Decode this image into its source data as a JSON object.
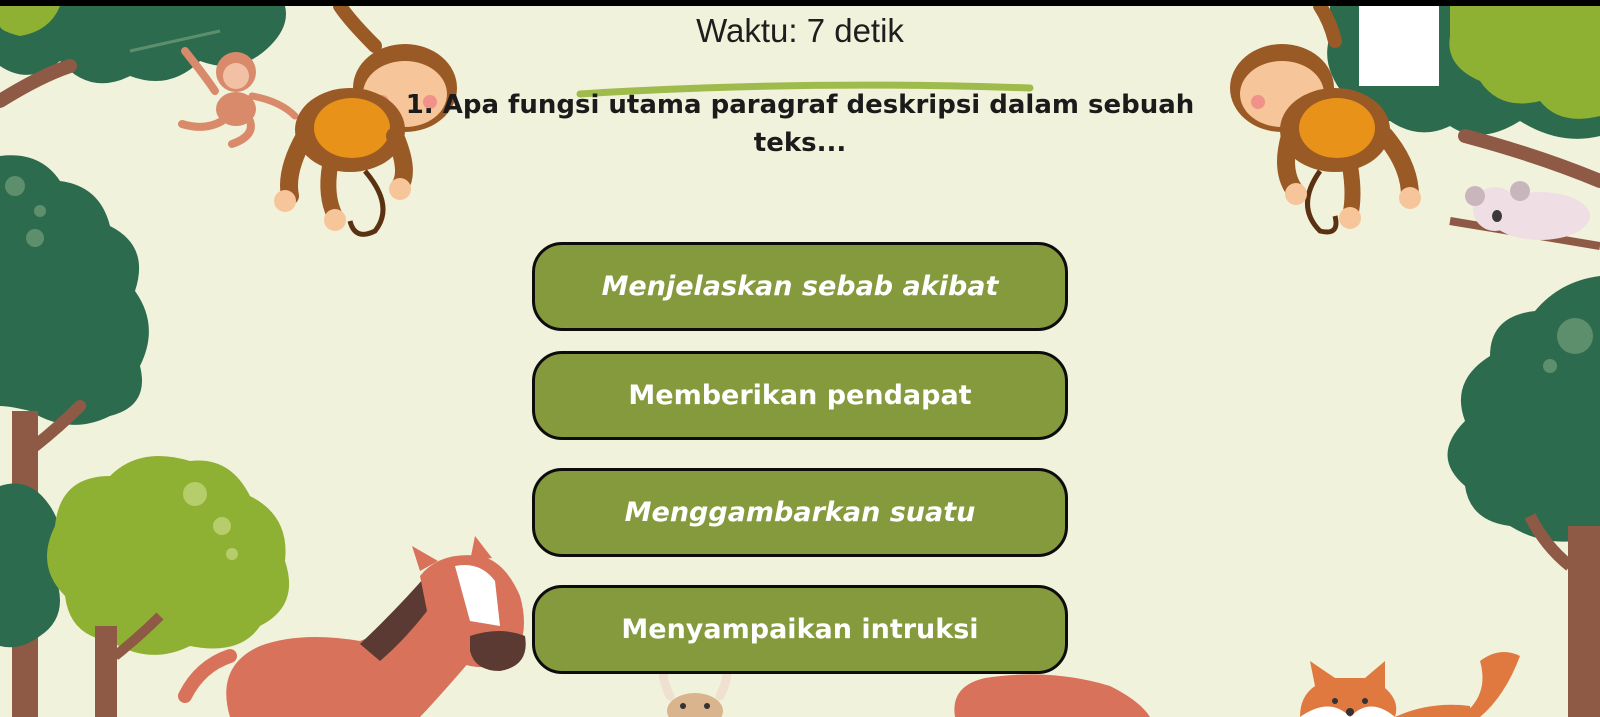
{
  "timer": {
    "text": "Waktu: 7 detik"
  },
  "question": {
    "text": "1. Apa fungsi utama paragraf deskripsi dalam sebuah teks..."
  },
  "answers": [
    {
      "label": "Menjelaskan sebab akibat",
      "italic": true
    },
    {
      "label": "Memberikan pendapat",
      "italic": false
    },
    {
      "label": "Menggambarkan suatu",
      "italic": true
    },
    {
      "label": "Menyampaikan intruksi",
      "italic": false
    }
  ],
  "colors": {
    "background": "#f1f2dc",
    "button": "#849a3d",
    "button_border": "#0c0c0c",
    "button_text": "#ffffff",
    "tree_dark": "#2d6b4e",
    "tree_light": "#8fb133",
    "trunk": "#8e5a45",
    "monkey": "#9a5a25"
  },
  "decorations": [
    "tree-icon",
    "monkey-icon",
    "koala-icon",
    "horse-icon",
    "fox-icon",
    "rabbit-icon"
  ]
}
